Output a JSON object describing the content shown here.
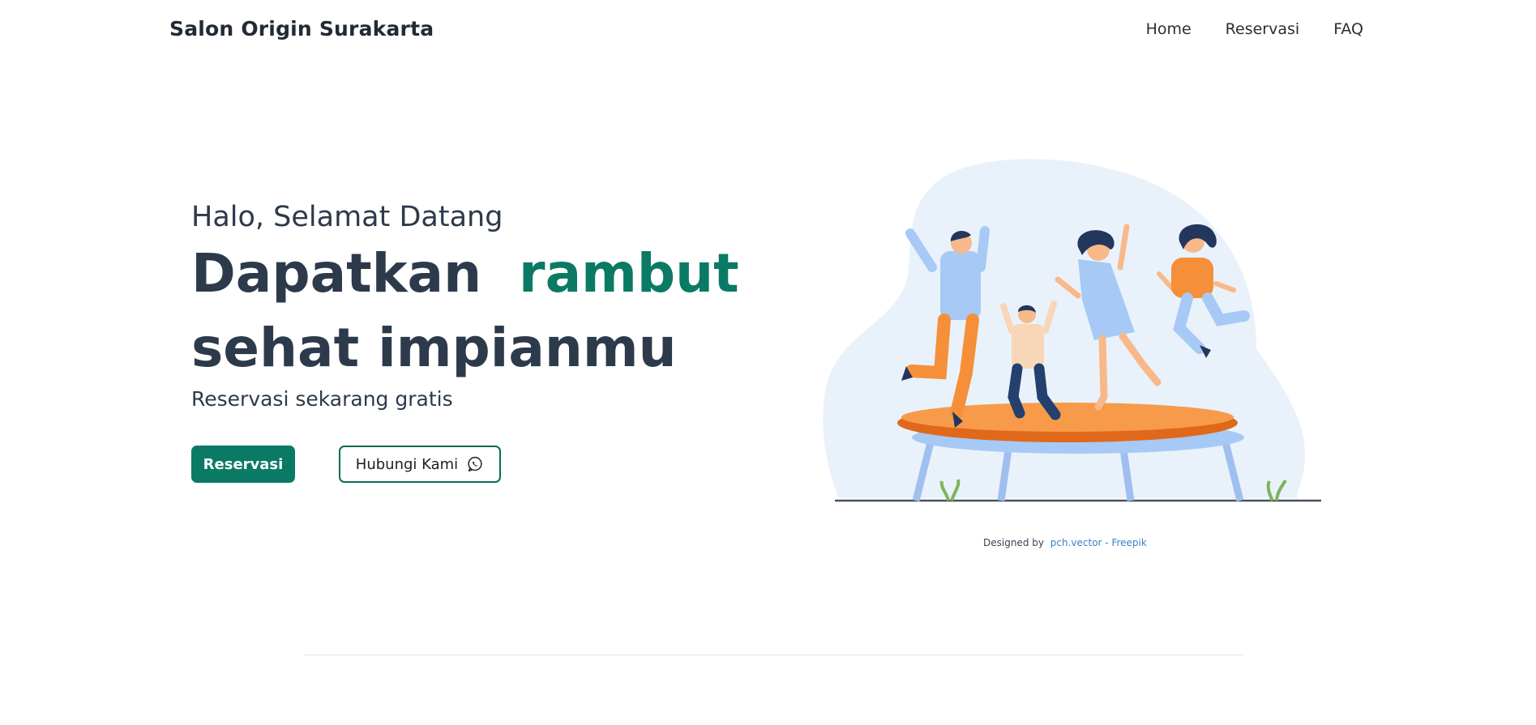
{
  "header": {
    "brand": "Salon Origin Surakarta",
    "nav": [
      "Home",
      "Reservasi",
      "FAQ"
    ]
  },
  "hero": {
    "greeting": "Halo, Selamat Datang",
    "headline_part1": "Dapatkan",
    "headline_accent": "rambut",
    "headline_part2": "sehat impianmu",
    "subtitle": "Reservasi sekarang gratis",
    "primary_button": "Reservasi",
    "secondary_button": "Hubungi Kami",
    "secondary_button_icon": "whatsapp-icon"
  },
  "credit": {
    "prefix": "Designed by",
    "link": "pch.vector - Freepik"
  },
  "colors": {
    "accent": "#0a7a64",
    "text": "#2d3a4b",
    "link": "#3a82c4"
  }
}
